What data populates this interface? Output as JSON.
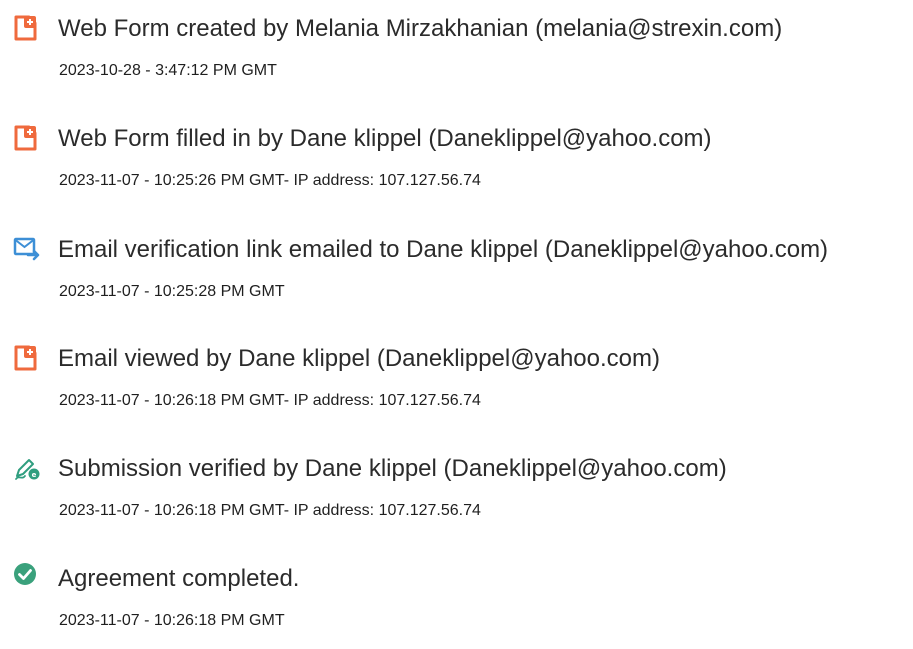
{
  "events": [
    {
      "icon": "document-add-icon",
      "title": "Web Form created by Melania Mirzakhanian (melania@strexin.com)",
      "meta": "2023-10-28 - 3:47:12 PM GMT"
    },
    {
      "icon": "document-add-icon",
      "title": "Web Form filled in by Dane klippel (Daneklippel@yahoo.com)",
      "meta": "2023-11-07 - 10:25:26 PM GMT- IP address: 107.127.56.74"
    },
    {
      "icon": "email-send-icon",
      "title": "Email verification link emailed to Dane klippel (Daneklippel@yahoo.com)",
      "meta": "2023-11-07 - 10:25:28 PM GMT"
    },
    {
      "icon": "document-add-icon",
      "title": "Email viewed by Dane klippel (Daneklippel@yahoo.com)",
      "meta": "2023-11-07 - 10:26:18 PM GMT- IP address: 107.127.56.74"
    },
    {
      "icon": "signature-verified-icon",
      "title": "Submission verified by Dane klippel (Daneklippel@yahoo.com)",
      "meta": "2023-11-07 - 10:26:18 PM GMT- IP address: 107.127.56.74"
    },
    {
      "icon": "check-circle-icon",
      "title": "Agreement completed.",
      "meta": "2023-11-07 - 10:26:18 PM GMT"
    }
  ],
  "colors": {
    "doc_icon": "#ef6a3d",
    "email_icon": "#3d8fd6",
    "signature_icon": "#2f9e7f",
    "check_icon": "#3aa17c"
  }
}
